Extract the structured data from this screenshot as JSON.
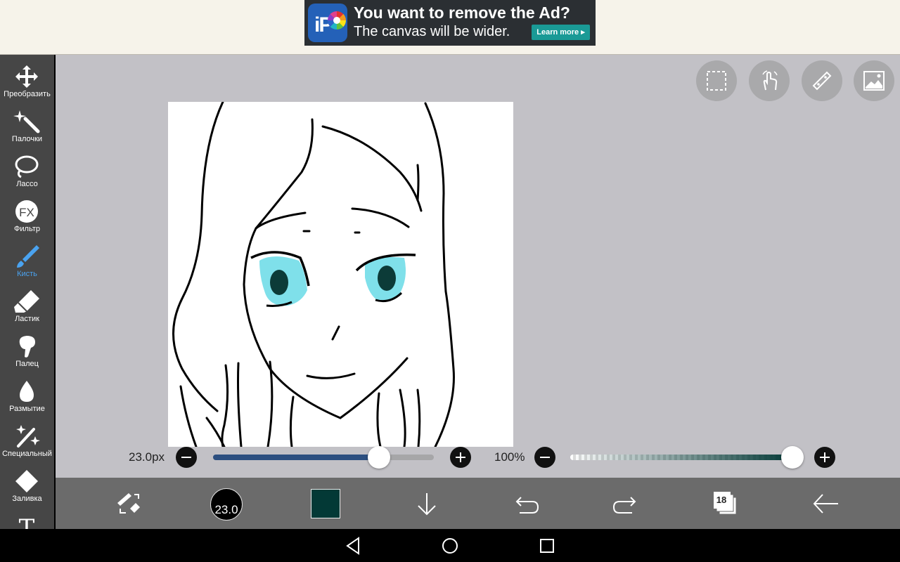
{
  "ad": {
    "logo_text": "iP",
    "headline": "You want to remove the Ad?",
    "subtext": "The canvas will be wider.",
    "button": "Learn more"
  },
  "sidebar": {
    "tools": [
      {
        "label": "Преобразить",
        "icon": "move-arrows-icon"
      },
      {
        "label": "Палочки",
        "icon": "magic-wand-icon"
      },
      {
        "label": "Лассо",
        "icon": "lasso-icon"
      },
      {
        "label": "Фильтр",
        "icon": "fx-filter-icon",
        "glyph": "FX"
      },
      {
        "label": "Кисть",
        "icon": "brush-icon",
        "active": true
      },
      {
        "label": "Ластик",
        "icon": "eraser-icon"
      },
      {
        "label": "Палец",
        "icon": "finger-smudge-icon"
      },
      {
        "label": "Размытие",
        "icon": "blur-drop-icon"
      },
      {
        "label": "Специальный",
        "icon": "special-brush-icon"
      },
      {
        "label": "Заливка",
        "icon": "fill-bucket-icon"
      },
      {
        "label": "",
        "icon": "text-tool-icon",
        "glyph": "T"
      }
    ]
  },
  "top_actions": [
    {
      "name": "selection-icon"
    },
    {
      "name": "hand-gesture-icon"
    },
    {
      "name": "ruler-icon"
    },
    {
      "name": "image-icon"
    }
  ],
  "sliders": {
    "size_label": "23.0px",
    "size_fraction": 0.75,
    "opacity_label": "100%",
    "opacity_fraction": 1.0
  },
  "bottom": {
    "brush_size": "23.0",
    "current_color": "#033936",
    "layers_count": "18"
  },
  "colors": {
    "accent": "#4aa3f0",
    "size_track": "#2c4f80",
    "opacity_track": "#033936",
    "ad_button": "#1a9a96"
  }
}
